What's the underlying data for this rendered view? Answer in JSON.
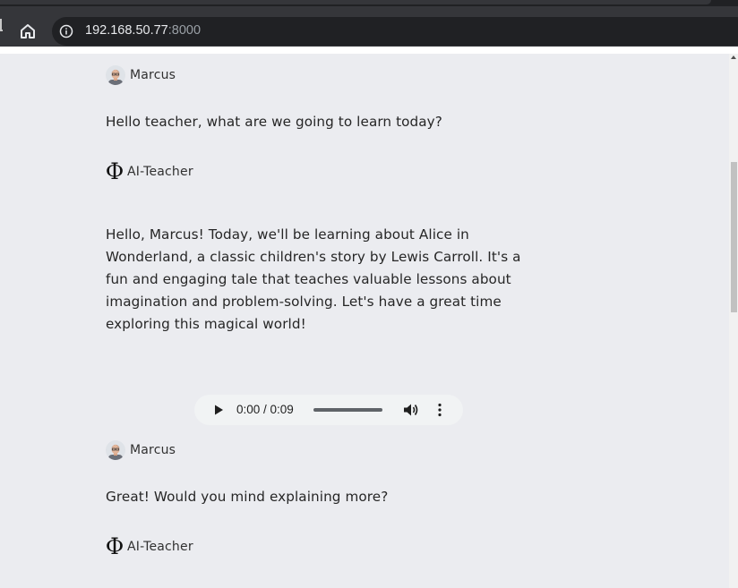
{
  "browser": {
    "url_host": "192.168.50.77",
    "url_port": ":8000"
  },
  "messages": [
    {
      "author": "Marcus",
      "role": "user",
      "text": "Hello teacher, what are we going to learn today?"
    },
    {
      "author": "AI-Teacher",
      "role": "assistant",
      "icon": "Φ",
      "text": "Hello, Marcus! Today, we'll be learning about Alice in Wonderland, a classic children's story by Lewis Carroll. It's a fun and engaging tale that teaches valuable lessons about imagination and problem-solving. Let's have a great time exploring this magical world!"
    },
    {
      "author": "Marcus",
      "role": "user",
      "text": "Great! Would you mind explaining more?"
    },
    {
      "author": "AI-Teacher",
      "role": "assistant",
      "icon": "Φ"
    }
  ],
  "audio": {
    "time": "0:00 / 0:09",
    "progress": 0.0
  },
  "colors": {
    "page_bg": "#ebecf0",
    "toolbar": "#35363a",
    "omnibox": "#202124",
    "audio_bg": "#f1f3f4"
  }
}
